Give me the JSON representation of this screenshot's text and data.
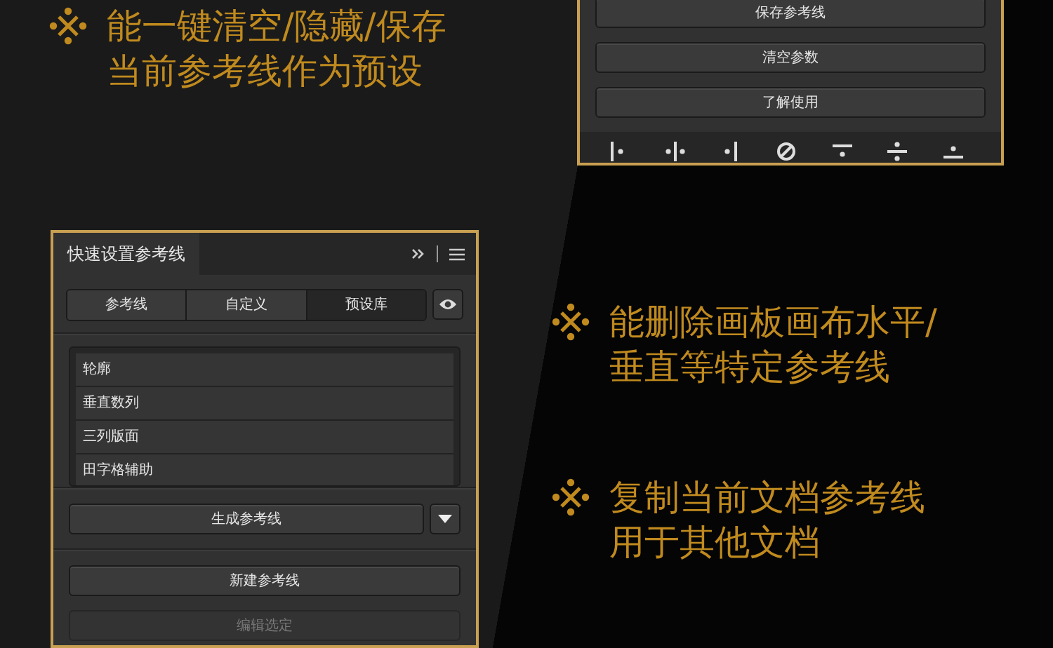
{
  "features": [
    {
      "lines": [
        "能一键清空/隐藏/保存",
        "当前参考线作为预设"
      ]
    },
    {
      "lines": [
        "能删除画板画布水平/",
        "垂直等特定参考线"
      ]
    },
    {
      "lines": [
        "复制当前文档参考线",
        "用于其他文档"
      ]
    }
  ],
  "top_panel": {
    "buttons": [
      "保存参考线",
      "清空参数",
      "了解使用"
    ]
  },
  "main_panel": {
    "title": "快速设置参考线",
    "tabs": [
      {
        "label": "参考线",
        "selected": false
      },
      {
        "label": "自定义",
        "selected": false
      },
      {
        "label": "预设库",
        "selected": true
      }
    ],
    "presets": [
      "轮廓",
      "垂直数列",
      "三列版面",
      "田字格辅助"
    ],
    "generate_button": "生成参考线",
    "buttons": [
      {
        "label": "新建参考线",
        "disabled": false
      },
      {
        "label": "编辑选定",
        "disabled": true
      }
    ]
  }
}
